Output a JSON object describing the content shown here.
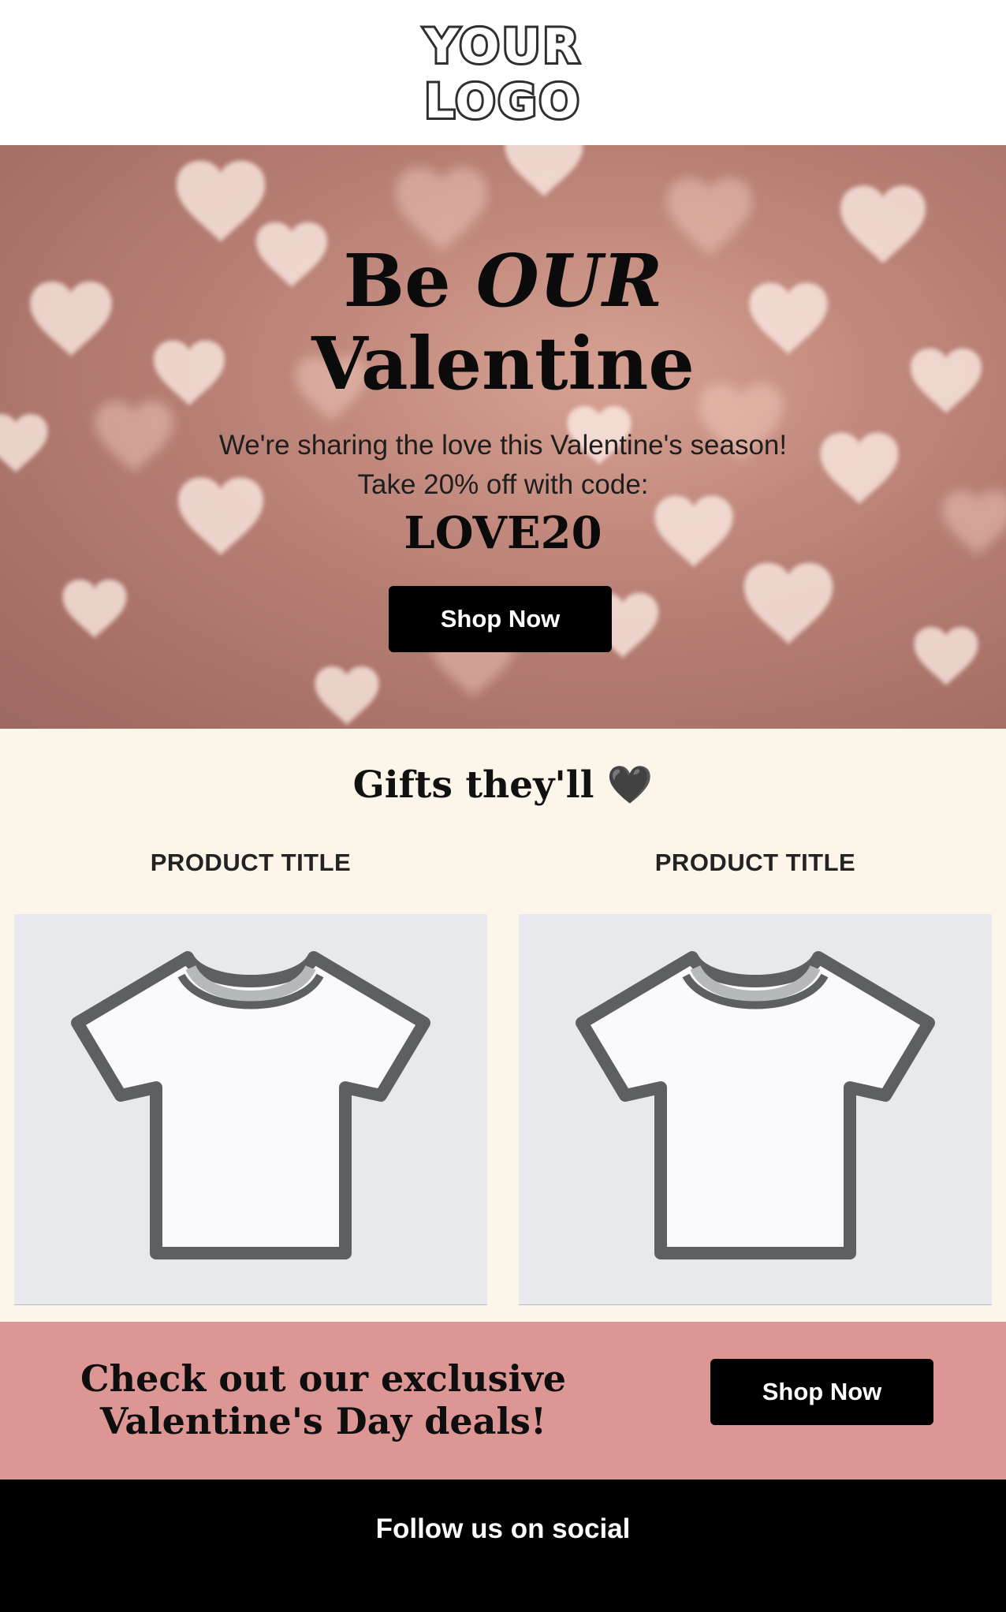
{
  "logo": {
    "line1": "YOUR",
    "line2": "LOGO"
  },
  "hero": {
    "title_part1": "Be ",
    "title_emphasis": "OUR",
    "title_line2": "Valentine",
    "subtitle_line1": "We're sharing the love this Valentine's season!",
    "subtitle_line2": "Take 20% off with code:",
    "promo_code": "LOVE20",
    "button_label": "Shop Now"
  },
  "gifts": {
    "heading": "Gifts they'll",
    "heading_icon": "🖤",
    "products": [
      {
        "title": "PRODUCT TITLE",
        "image_icon": "tshirt-icon"
      },
      {
        "title": "PRODUCT TITLE",
        "image_icon": "tshirt-icon"
      }
    ]
  },
  "cta": {
    "text_line1": "Check out our exclusive",
    "text_line2": "Valentine's Day deals!",
    "button_label": "Shop Now"
  },
  "footer": {
    "text": "Follow us on social"
  },
  "colors": {
    "hero_bg": "#b98075",
    "gifts_bg": "#fbf5ea",
    "product_bg": "#e8e9ec",
    "cta_bg": "#dc9694",
    "footer_bg": "#000000",
    "button_bg": "#000000"
  }
}
